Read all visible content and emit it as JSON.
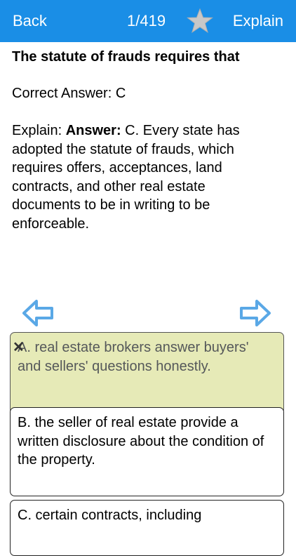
{
  "nav": {
    "back_label": "Back",
    "counter": "1/419",
    "explain_label": "Explain",
    "star_icon": "star-icon",
    "bar_color": "#1a8ee6"
  },
  "question": "The statute of frauds requires that",
  "correct_answer": "Correct Answer: C",
  "explanation": {
    "prefix": "Explain: ",
    "bold": "Answer:",
    "body": " C. Every state has adopted the statute of frauds, which requires offers, acceptances, land contracts, and other real estate documents to be in writing to be enforceable."
  },
  "navigation_arrows": {
    "prev_icon": "arrow-left-icon",
    "next_icon": "arrow-right-icon",
    "color": "#5aa8e6"
  },
  "options": [
    {
      "label": "A. real estate brokers answer buyers' and sellers' questions honestly.",
      "state": "wrong",
      "mark_icon": "x-icon",
      "highlight": "#e6eab7"
    },
    {
      "label": "B. the seller of real estate provide a written disclosure about the condition of the property.",
      "state": "normal"
    },
    {
      "label": "C. certain contracts, including",
      "state": "normal"
    }
  ]
}
